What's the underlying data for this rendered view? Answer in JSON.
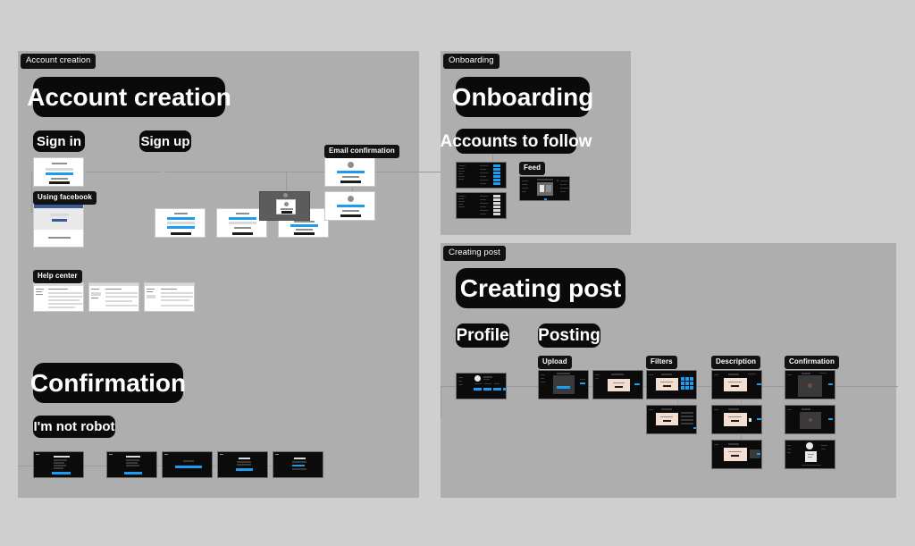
{
  "canvas": {
    "background_color": "#cfcfcf",
    "frame_color": "#aeaeae",
    "accent_color": "#1d9bf0",
    "chip_color": "#121212"
  },
  "frames": [
    {
      "tag": "Account creation",
      "title": "Account creation",
      "sections": [
        {
          "label": "Sign in"
        },
        {
          "label": "Sign up"
        },
        {
          "label": "Using facebook"
        },
        {
          "label": "Email confirmation"
        },
        {
          "label": "Help center"
        },
        {
          "label": "Confirmation"
        },
        {
          "label": "I'm not robot"
        }
      ]
    },
    {
      "tag": "Onboarding",
      "title": "Onboarding",
      "sections": [
        {
          "label": "Accounts to follow"
        },
        {
          "label": "Feed"
        }
      ]
    },
    {
      "tag": "Creating post",
      "title": "Creating post",
      "sections": [
        {
          "label": "Profile"
        },
        {
          "label": "Posting"
        },
        {
          "label": "Upload"
        },
        {
          "label": "Filters"
        },
        {
          "label": "Description"
        },
        {
          "label": "Confirmation"
        }
      ]
    }
  ],
  "account_creation": {
    "tag": "Account creation",
    "title": "Account creation",
    "sign_in_label": "Sign in",
    "sign_up_label": "Sign up",
    "using_facebook_label": "Using facebook",
    "email_confirmation_label": "Email confirmation",
    "help_center_label": "Help center",
    "confirmation_label": "Confirmation",
    "not_robot_label": "I'm not robot"
  },
  "onboarding": {
    "tag": "Onboarding",
    "title": "Onboarding",
    "accounts_to_follow_label": "Accounts to follow",
    "feed_label": "Feed"
  },
  "creating_post": {
    "tag": "Creating post",
    "title": "Creating post",
    "profile_label": "Profile",
    "posting_label": "Posting",
    "upload_label": "Upload",
    "filters_label": "Filters",
    "description_label": "Description",
    "confirmation_label": "Confirmation"
  }
}
